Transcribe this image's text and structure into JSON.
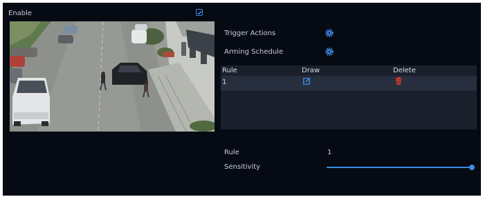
{
  "enable": {
    "label": "Enable",
    "checked": true
  },
  "actions": {
    "trigger_label": "Trigger Actions",
    "schedule_label": "Arming Schedule"
  },
  "rules_table": {
    "headers": [
      "Rule",
      "Draw",
      "Delete"
    ],
    "rows": [
      {
        "rule": "1"
      }
    ]
  },
  "detail": {
    "rule_label": "Rule",
    "rule_value": "1",
    "sensitivity_label": "Sensitivity",
    "sensitivity_level": 1.0
  },
  "colors": {
    "accent": "#3c8de8",
    "delete": "#e0392b",
    "panel_bg": "#060a13"
  }
}
